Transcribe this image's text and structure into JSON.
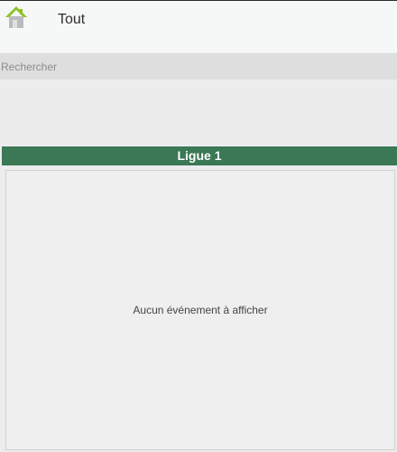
{
  "header": {
    "title": "Tout",
    "home_icon": "home-icon",
    "home_icon_colors": {
      "roof": "#8cc224",
      "body": "#b8bcbf",
      "door": "#e0e0e0"
    }
  },
  "search": {
    "placeholder": "Rechercher",
    "value": ""
  },
  "league": {
    "title": "Ligue 1",
    "color": "#3a7856"
  },
  "events": {
    "empty_message": "Aucun événement à afficher"
  }
}
